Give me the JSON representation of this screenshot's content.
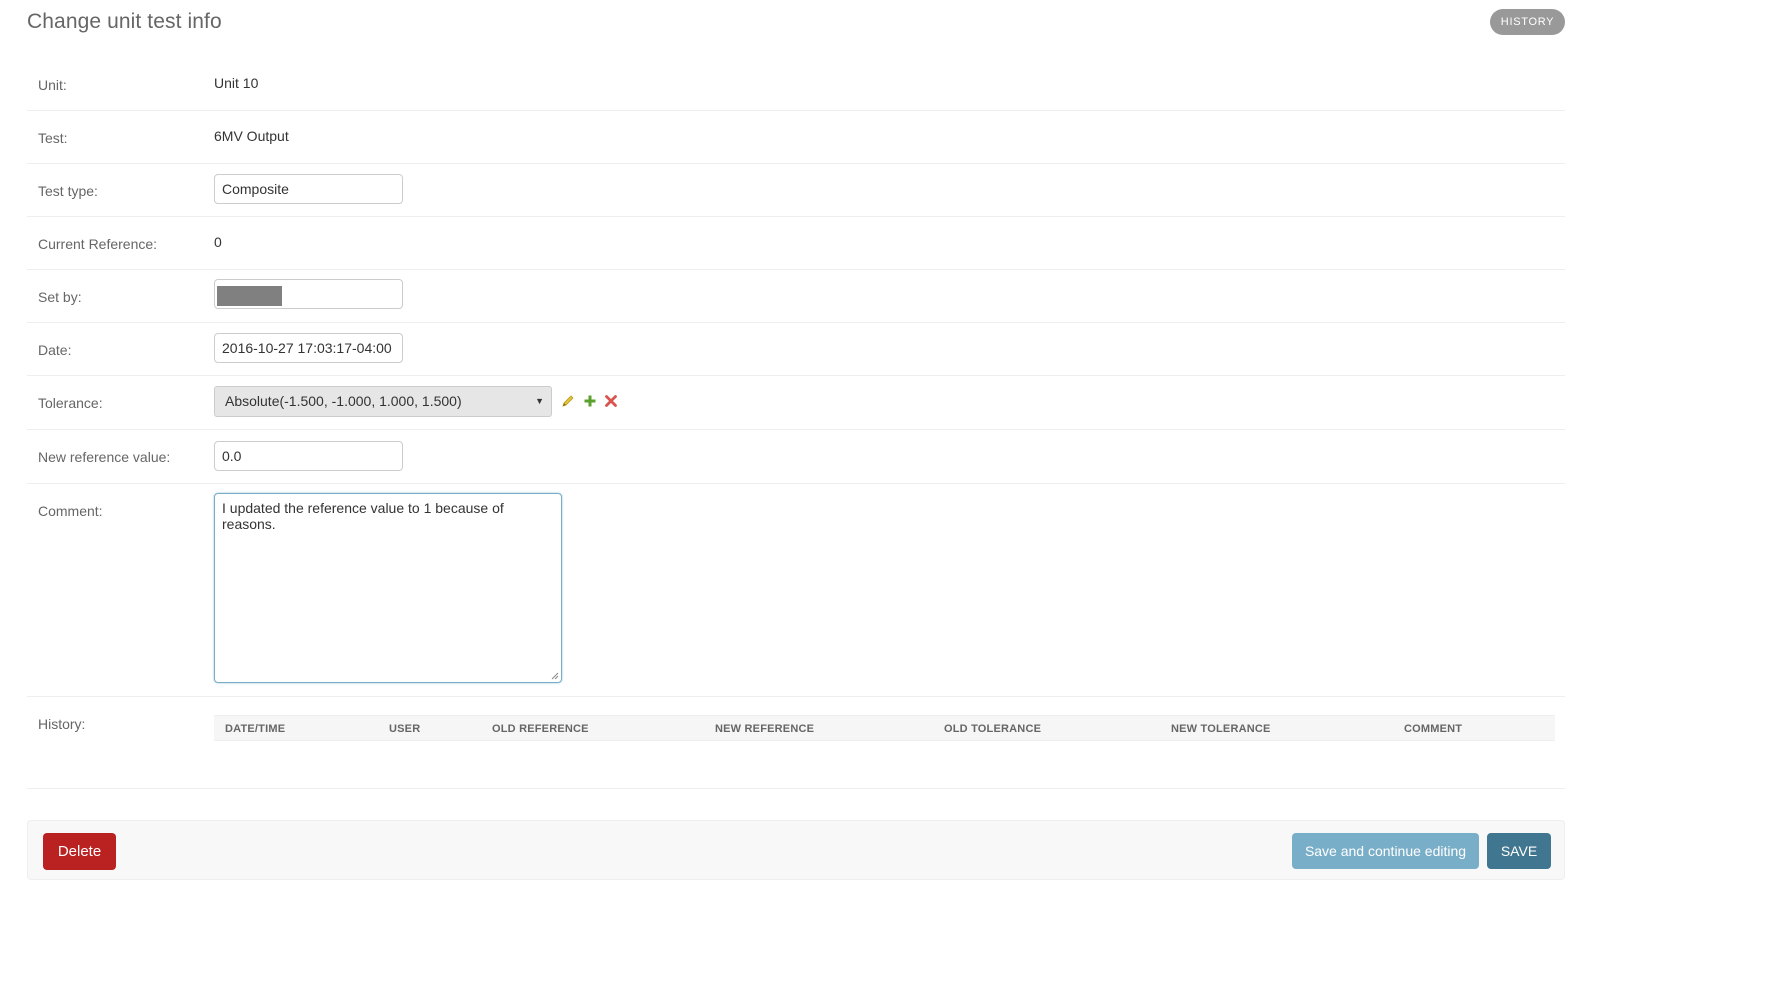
{
  "page": {
    "title": "Change unit test info",
    "history_button": "HISTORY"
  },
  "form": {
    "unit": {
      "label": "Unit:",
      "value": "Unit 10"
    },
    "test": {
      "label": "Test:",
      "value": "6MV Output"
    },
    "test_type": {
      "label": "Test type:",
      "value": "Composite"
    },
    "current_reference": {
      "label": "Current Reference:",
      "value": "0"
    },
    "set_by": {
      "label": "Set by:",
      "value": ""
    },
    "date": {
      "label": "Date:",
      "value": "2016-10-27 17:03:17-04:00"
    },
    "tolerance": {
      "label": "Tolerance:",
      "selected": "Absolute(-1.500, -1.000, 1.000, 1.500)",
      "icons": [
        "pencil-icon",
        "plus-icon",
        "close-icon"
      ],
      "icon_colors": {
        "edit": "#e0c43a",
        "add": "#5aa02c",
        "delete": "#d9534f"
      }
    },
    "new_reference": {
      "label": "New reference value:",
      "value": "0.0"
    },
    "comment": {
      "label": "Comment:",
      "value": "I updated the reference value to 1 because of reasons."
    },
    "history": {
      "label": "History:",
      "columns": [
        "DATE/TIME",
        "USER",
        "OLD REFERENCE",
        "NEW REFERENCE",
        "OLD TOLERANCE",
        "NEW TOLERANCE",
        "COMMENT"
      ],
      "rows": []
    }
  },
  "submit": {
    "delete": "Delete",
    "save_continue": "Save and continue editing",
    "save": "SAVE"
  },
  "colors": {
    "delete": "#ba2121",
    "save_continue": "#79aec8",
    "save": "#417690",
    "history_button": "#999999"
  }
}
